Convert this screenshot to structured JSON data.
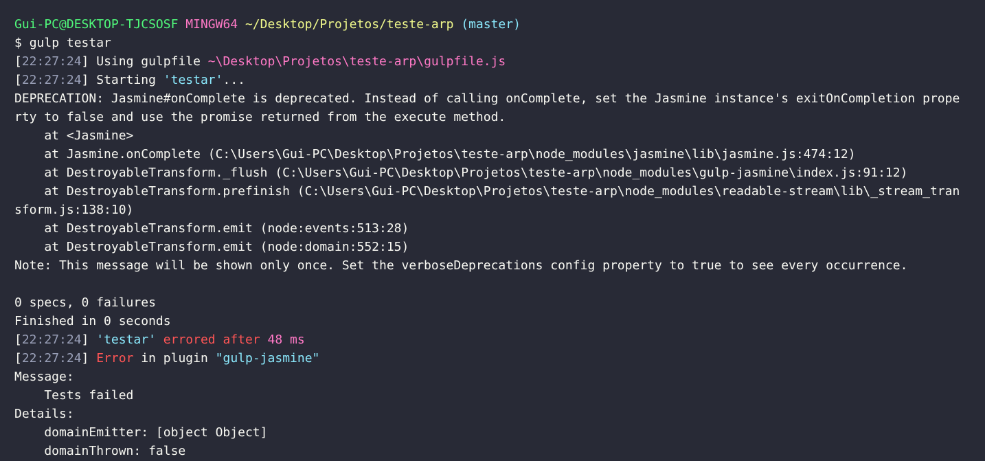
{
  "prompt": {
    "user_host": "Gui-PC@DESKTOP-TJCSOSF",
    "system": "MINGW64",
    "path": "~/Desktop/Projetos/teste-arp",
    "branch": "(master)",
    "symbol": "$",
    "command": "gulp testar"
  },
  "log": {
    "using_time": "22:27:24",
    "using_label": "Using gulpfile",
    "gulpfile_path": "~\\Desktop\\Projetos\\teste-arp\\gulpfile.js",
    "starting_time": "22:27:24",
    "starting_label": "Starting",
    "task_name": "'testar'",
    "ellipsis": "..."
  },
  "deprecation": {
    "line1": "DEPRECATION: Jasmine#onComplete is deprecated. Instead of calling onComplete, set the Jasmine instance's exitOnCompletion prope",
    "line2": "rty to false and use the promise returned from the execute method.",
    "stack": [
      "    at <Jasmine>",
      "    at Jasmine.onComplete (C:\\Users\\Gui-PC\\Desktop\\Projetos\\teste-arp\\node_modules\\jasmine\\lib\\jasmine.js:474:12)",
      "    at DestroyableTransform._flush (C:\\Users\\Gui-PC\\Desktop\\Projetos\\teste-arp\\node_modules\\gulp-jasmine\\index.js:91:12)",
      "    at DestroyableTransform.prefinish (C:\\Users\\Gui-PC\\Desktop\\Projetos\\teste-arp\\node_modules\\readable-stream\\lib\\_stream_tran",
      "sform.js:138:10)",
      "    at DestroyableTransform.emit (node:events:513:28)",
      "    at DestroyableTransform.emit (node:domain:552:15)"
    ],
    "note": "Note: This message will be shown only once. Set the verboseDeprecations config property to true to see every occurrence."
  },
  "results": {
    "specs": "0 specs, 0 failures",
    "finished": "Finished in 0 seconds"
  },
  "errored": {
    "time": "22:27:24",
    "task_name": "'testar'",
    "label": "errored after",
    "duration": "48 ms"
  },
  "plugin_error": {
    "time": "22:27:24",
    "error_word": "Error",
    "in_plugin": "in plugin",
    "plugin_name": "\"gulp-jasmine\""
  },
  "details": {
    "message_label": "Message:",
    "message_value": "    Tests failed",
    "details_label": "Details:",
    "domain_emitter": "    domainEmitter: [object Object]",
    "domain_thrown": "    domainThrown: false"
  },
  "colors": {
    "background": "#282a36",
    "foreground": "#f8f8f2",
    "green": "#50fa7b",
    "magenta": "#ff79c6",
    "yellow": "#f1fa8c",
    "cyan": "#8be9fd",
    "red": "#ff5555",
    "timestamp": "#9aa0b8"
  }
}
